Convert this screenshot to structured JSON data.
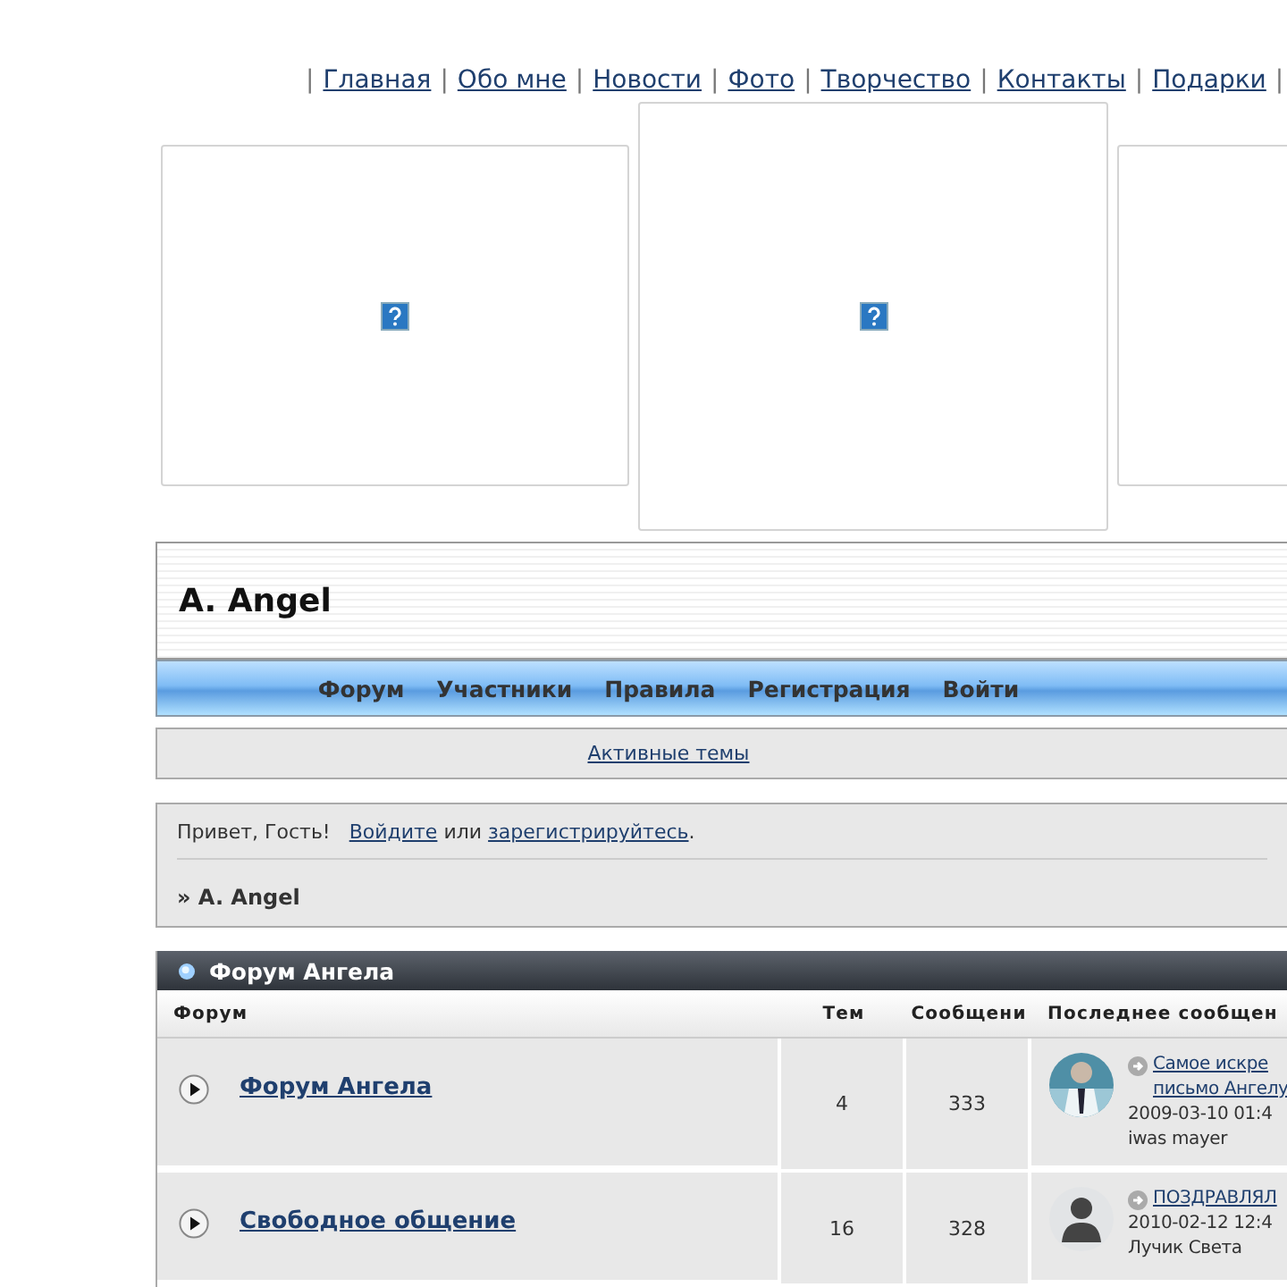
{
  "nav_separator": "|",
  "nav_links": [
    "Главная",
    "Обо мне",
    "Новости",
    "Фото",
    "Творчество",
    "Контакты",
    "Подарки"
  ],
  "image_frames": [
    {
      "broken_icon": true,
      "tall": false
    },
    {
      "broken_icon": true,
      "tall": true
    },
    {
      "tall": false
    }
  ],
  "site_title": "A. Angel",
  "menu": [
    "Форум",
    "Участники",
    "Правила",
    "Регистрация",
    "Войти"
  ],
  "active_topics_link": "Активные темы",
  "greeting": {
    "text": "Привет, Гость!",
    "login_link": "Войдите",
    "or": "или",
    "register_link": "зарегистрируйтесь",
    "end": "."
  },
  "breadcrumb": "» A. Angel",
  "category": {
    "title": "Форум Ангела",
    "columns": [
      "Форум",
      "Тем",
      "Сообщени",
      "Последнее сообщен"
    ],
    "rows": [
      {
        "name": "Форум Ангела",
        "topics": "4",
        "posts": "333",
        "last_post": {
          "avatar": {
            "kind": "picture"
          },
          "title_lines": [
            "Самое искре",
            "письмо Ангелу"
          ],
          "date": "2009-03-10 01:4",
          "author": "iwas mayer"
        }
      },
      {
        "name": "Свободное общение",
        "topics": "16",
        "posts": "328",
        "last_post": {
          "avatar": {
            "kind": "silhouette"
          },
          "title_lines": [
            "ПОЗДРАВЛЯЛ"
          ],
          "date": "2010-02-12 12:4",
          "author": "Лучик Света"
        }
      }
    ]
  }
}
